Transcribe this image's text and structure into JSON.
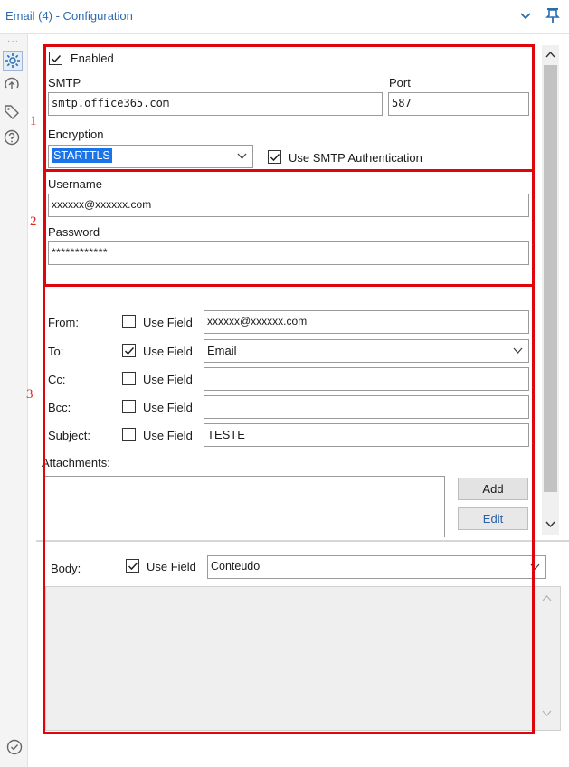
{
  "window": {
    "title": "Email (4) - Configuration"
  },
  "sidebar": {
    "dots": "···"
  },
  "annotations": [
    "1",
    "2",
    "3"
  ],
  "config": {
    "enabled_label": "Enabled",
    "smtp_label": "SMTP",
    "smtp_value": "smtp.office365.com",
    "port_label": "Port",
    "port_value": "587",
    "encryption_label": "Encryption",
    "encryption_value": "STARTTLS",
    "use_smtp_auth_label": "Use SMTP Authentication",
    "username_label": "Username",
    "username_value": "xxxxxx@xxxxxx.com",
    "password_label": "Password",
    "password_value": "************"
  },
  "fields": {
    "use_field_label": "Use Field",
    "rows": [
      {
        "label": "From:",
        "use_field": false,
        "value": "xxxxxx@xxxxxx.com",
        "dropdown": false
      },
      {
        "label": "To:",
        "use_field": true,
        "value": "Email",
        "dropdown": true
      },
      {
        "label": "Cc:",
        "use_field": false,
        "value": "",
        "dropdown": false
      },
      {
        "label": "Bcc:",
        "use_field": false,
        "value": "",
        "dropdown": false
      },
      {
        "label": "Subject:",
        "use_field": false,
        "value": "TESTE",
        "dropdown": false
      }
    ],
    "attachments_label": "Attachments:",
    "add_label": "Add",
    "edit_label": "Edit",
    "body_label": "Body:",
    "body_use_field_label": "Use Field",
    "body_value": "Conteudo"
  },
  "colors": {
    "accent": "#2b6cb0",
    "highlight": "#e0040b",
    "selection": "#1a73e8"
  }
}
